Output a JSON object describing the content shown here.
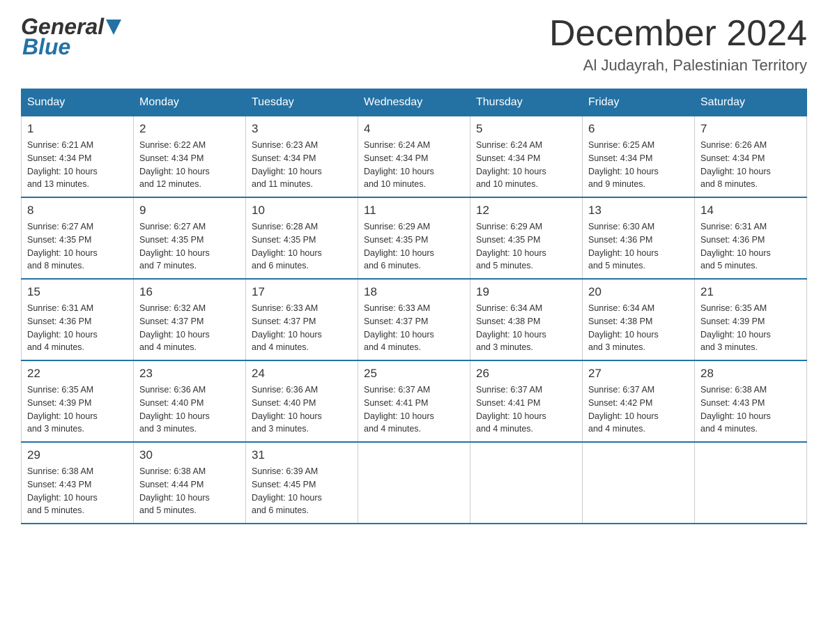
{
  "header": {
    "logo_general": "General",
    "logo_blue": "Blue",
    "month_title": "December 2024",
    "location": "Al Judayrah, Palestinian Territory"
  },
  "calendar": {
    "days_of_week": [
      "Sunday",
      "Monday",
      "Tuesday",
      "Wednesday",
      "Thursday",
      "Friday",
      "Saturday"
    ],
    "weeks": [
      [
        {
          "day": "1",
          "sunrise": "6:21 AM",
          "sunset": "4:34 PM",
          "daylight": "10 hours and 13 minutes."
        },
        {
          "day": "2",
          "sunrise": "6:22 AM",
          "sunset": "4:34 PM",
          "daylight": "10 hours and 12 minutes."
        },
        {
          "day": "3",
          "sunrise": "6:23 AM",
          "sunset": "4:34 PM",
          "daylight": "10 hours and 11 minutes."
        },
        {
          "day": "4",
          "sunrise": "6:24 AM",
          "sunset": "4:34 PM",
          "daylight": "10 hours and 10 minutes."
        },
        {
          "day": "5",
          "sunrise": "6:24 AM",
          "sunset": "4:34 PM",
          "daylight": "10 hours and 10 minutes."
        },
        {
          "day": "6",
          "sunrise": "6:25 AM",
          "sunset": "4:34 PM",
          "daylight": "10 hours and 9 minutes."
        },
        {
          "day": "7",
          "sunrise": "6:26 AM",
          "sunset": "4:34 PM",
          "daylight": "10 hours and 8 minutes."
        }
      ],
      [
        {
          "day": "8",
          "sunrise": "6:27 AM",
          "sunset": "4:35 PM",
          "daylight": "10 hours and 8 minutes."
        },
        {
          "day": "9",
          "sunrise": "6:27 AM",
          "sunset": "4:35 PM",
          "daylight": "10 hours and 7 minutes."
        },
        {
          "day": "10",
          "sunrise": "6:28 AM",
          "sunset": "4:35 PM",
          "daylight": "10 hours and 6 minutes."
        },
        {
          "day": "11",
          "sunrise": "6:29 AM",
          "sunset": "4:35 PM",
          "daylight": "10 hours and 6 minutes."
        },
        {
          "day": "12",
          "sunrise": "6:29 AM",
          "sunset": "4:35 PM",
          "daylight": "10 hours and 5 minutes."
        },
        {
          "day": "13",
          "sunrise": "6:30 AM",
          "sunset": "4:36 PM",
          "daylight": "10 hours and 5 minutes."
        },
        {
          "day": "14",
          "sunrise": "6:31 AM",
          "sunset": "4:36 PM",
          "daylight": "10 hours and 5 minutes."
        }
      ],
      [
        {
          "day": "15",
          "sunrise": "6:31 AM",
          "sunset": "4:36 PM",
          "daylight": "10 hours and 4 minutes."
        },
        {
          "day": "16",
          "sunrise": "6:32 AM",
          "sunset": "4:37 PM",
          "daylight": "10 hours and 4 minutes."
        },
        {
          "day": "17",
          "sunrise": "6:33 AM",
          "sunset": "4:37 PM",
          "daylight": "10 hours and 4 minutes."
        },
        {
          "day": "18",
          "sunrise": "6:33 AM",
          "sunset": "4:37 PM",
          "daylight": "10 hours and 4 minutes."
        },
        {
          "day": "19",
          "sunrise": "6:34 AM",
          "sunset": "4:38 PM",
          "daylight": "10 hours and 3 minutes."
        },
        {
          "day": "20",
          "sunrise": "6:34 AM",
          "sunset": "4:38 PM",
          "daylight": "10 hours and 3 minutes."
        },
        {
          "day": "21",
          "sunrise": "6:35 AM",
          "sunset": "4:39 PM",
          "daylight": "10 hours and 3 minutes."
        }
      ],
      [
        {
          "day": "22",
          "sunrise": "6:35 AM",
          "sunset": "4:39 PM",
          "daylight": "10 hours and 3 minutes."
        },
        {
          "day": "23",
          "sunrise": "6:36 AM",
          "sunset": "4:40 PM",
          "daylight": "10 hours and 3 minutes."
        },
        {
          "day": "24",
          "sunrise": "6:36 AM",
          "sunset": "4:40 PM",
          "daylight": "10 hours and 3 minutes."
        },
        {
          "day": "25",
          "sunrise": "6:37 AM",
          "sunset": "4:41 PM",
          "daylight": "10 hours and 4 minutes."
        },
        {
          "day": "26",
          "sunrise": "6:37 AM",
          "sunset": "4:41 PM",
          "daylight": "10 hours and 4 minutes."
        },
        {
          "day": "27",
          "sunrise": "6:37 AM",
          "sunset": "4:42 PM",
          "daylight": "10 hours and 4 minutes."
        },
        {
          "day": "28",
          "sunrise": "6:38 AM",
          "sunset": "4:43 PM",
          "daylight": "10 hours and 4 minutes."
        }
      ],
      [
        {
          "day": "29",
          "sunrise": "6:38 AM",
          "sunset": "4:43 PM",
          "daylight": "10 hours and 5 minutes."
        },
        {
          "day": "30",
          "sunrise": "6:38 AM",
          "sunset": "4:44 PM",
          "daylight": "10 hours and 5 minutes."
        },
        {
          "day": "31",
          "sunrise": "6:39 AM",
          "sunset": "4:45 PM",
          "daylight": "10 hours and 6 minutes."
        },
        {
          "day": "",
          "sunrise": "",
          "sunset": "",
          "daylight": ""
        },
        {
          "day": "",
          "sunrise": "",
          "sunset": "",
          "daylight": ""
        },
        {
          "day": "",
          "sunrise": "",
          "sunset": "",
          "daylight": ""
        },
        {
          "day": "",
          "sunrise": "",
          "sunset": "",
          "daylight": ""
        }
      ]
    ],
    "labels": {
      "sunrise": "Sunrise: ",
      "sunset": "Sunset: ",
      "daylight": "Daylight: "
    }
  }
}
